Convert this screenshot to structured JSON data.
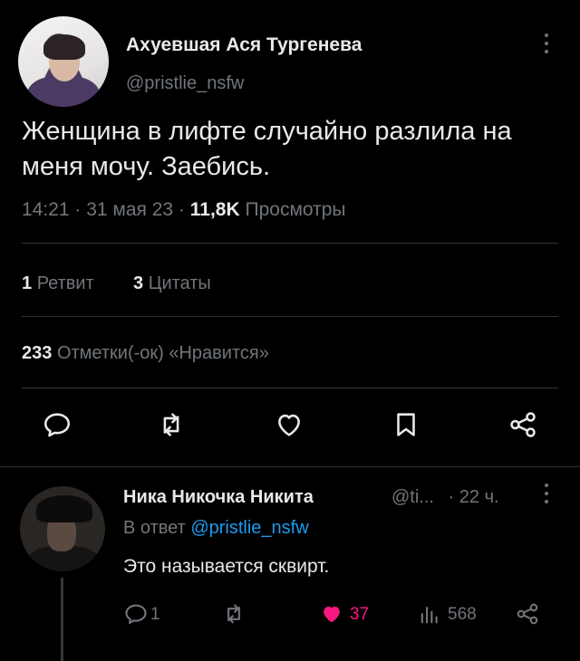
{
  "tweet": {
    "author_name": "Ахуевшая Ася Тургенева",
    "author_handle": "@pristlie_nsfw",
    "text": "Женщина в лифте случайно  разлила на меня мочу. Заебись.",
    "time": "14:21 · 31 мая 23 ·",
    "views_count": "11,8K",
    "views_label": "Просмотры",
    "retweets_count": "1",
    "retweets_label": "Ретвит",
    "quotes_count": "3",
    "quotes_label": "Цитаты",
    "likes_count": "233",
    "likes_label": "Отметки(-ок) «Нравится»",
    "actions": [
      "reply-icon",
      "retweet-icon",
      "like-icon",
      "bookmark-icon",
      "share-icon"
    ]
  },
  "reply": {
    "author_name": "Ника Никочка Никита",
    "author_handle": "@ti...",
    "time": "· 22 ч.",
    "reply_prefix": "В ответ",
    "reply_to_handle": "@pristlie_nsfw",
    "text": "Это называется сквирт.",
    "replies": "1",
    "likes": "37",
    "views": "568"
  },
  "colors": {
    "background": "#000000",
    "text": "#e7e9ea",
    "muted": "#71767b",
    "link": "#1d9bf0",
    "like": "#f91880",
    "divider": "#2f3336"
  }
}
